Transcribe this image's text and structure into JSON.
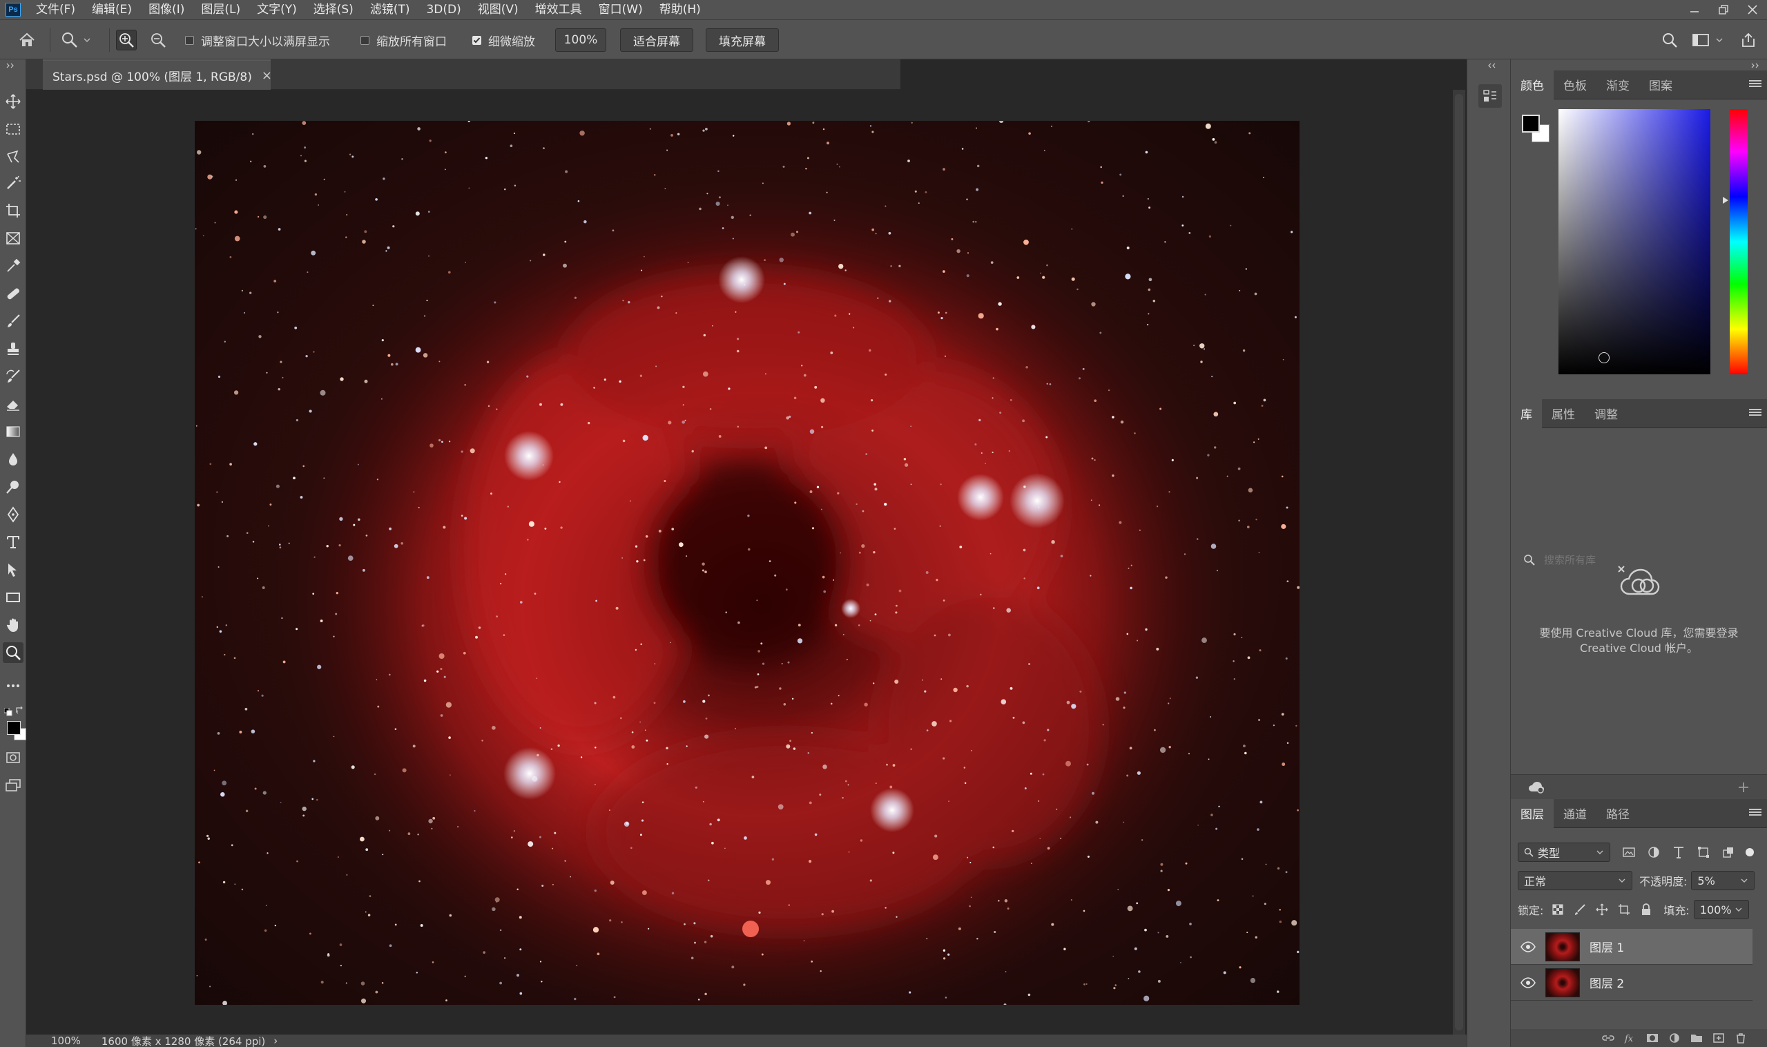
{
  "app": {
    "logo": "Ps",
    "menu": [
      "文件(F)",
      "编辑(E)",
      "图像(I)",
      "图层(L)",
      "文字(Y)",
      "选择(S)",
      "滤镜(T)",
      "3D(D)",
      "视图(V)",
      "增效工具",
      "窗口(W)",
      "帮助(H)"
    ]
  },
  "options": {
    "resize_windows": "调整窗口大小以满屏显示",
    "zoom_all": "缩放所有窗口",
    "scrubby_zoom": "细微缩放",
    "zoom_value": "100%",
    "fit_screen": "适合屏幕",
    "fill_screen": "填充屏幕"
  },
  "document": {
    "tab_title": "Stars.psd @ 100% (图层 1, RGB/8)",
    "tab_close": "×"
  },
  "status": {
    "zoom": "100%",
    "info": "1600 像素 x 1280 像素 (264 ppi)",
    "arrow": "›"
  },
  "panels": {
    "color_tabs": [
      "颜色",
      "色板",
      "渐变",
      "图案"
    ],
    "library_tabs": [
      "库",
      "属性",
      "调整"
    ],
    "library_search_placeholder": "搜索所有库",
    "cc_message_line1": "要使用 Creative Cloud 库，您需要登录",
    "cc_message_line2": "Creative Cloud 帐户。",
    "layers_tabs": [
      "图层",
      "通道",
      "路径"
    ],
    "filter_kind": "类型",
    "blend_mode": "正常",
    "opacity_label": "不透明度:",
    "opacity_value": "5%",
    "lock_label": "锁定:",
    "fill_label": "填充:",
    "fill_value": "100%",
    "layers": [
      {
        "name": "图层 1",
        "selected": true
      },
      {
        "name": "图层 2",
        "selected": false
      }
    ]
  },
  "colors": {
    "ui_bg": "#535353",
    "dark_bg": "#282828",
    "accent": "#31a8ff",
    "foreground": "#000000",
    "background": "#ffffff"
  }
}
